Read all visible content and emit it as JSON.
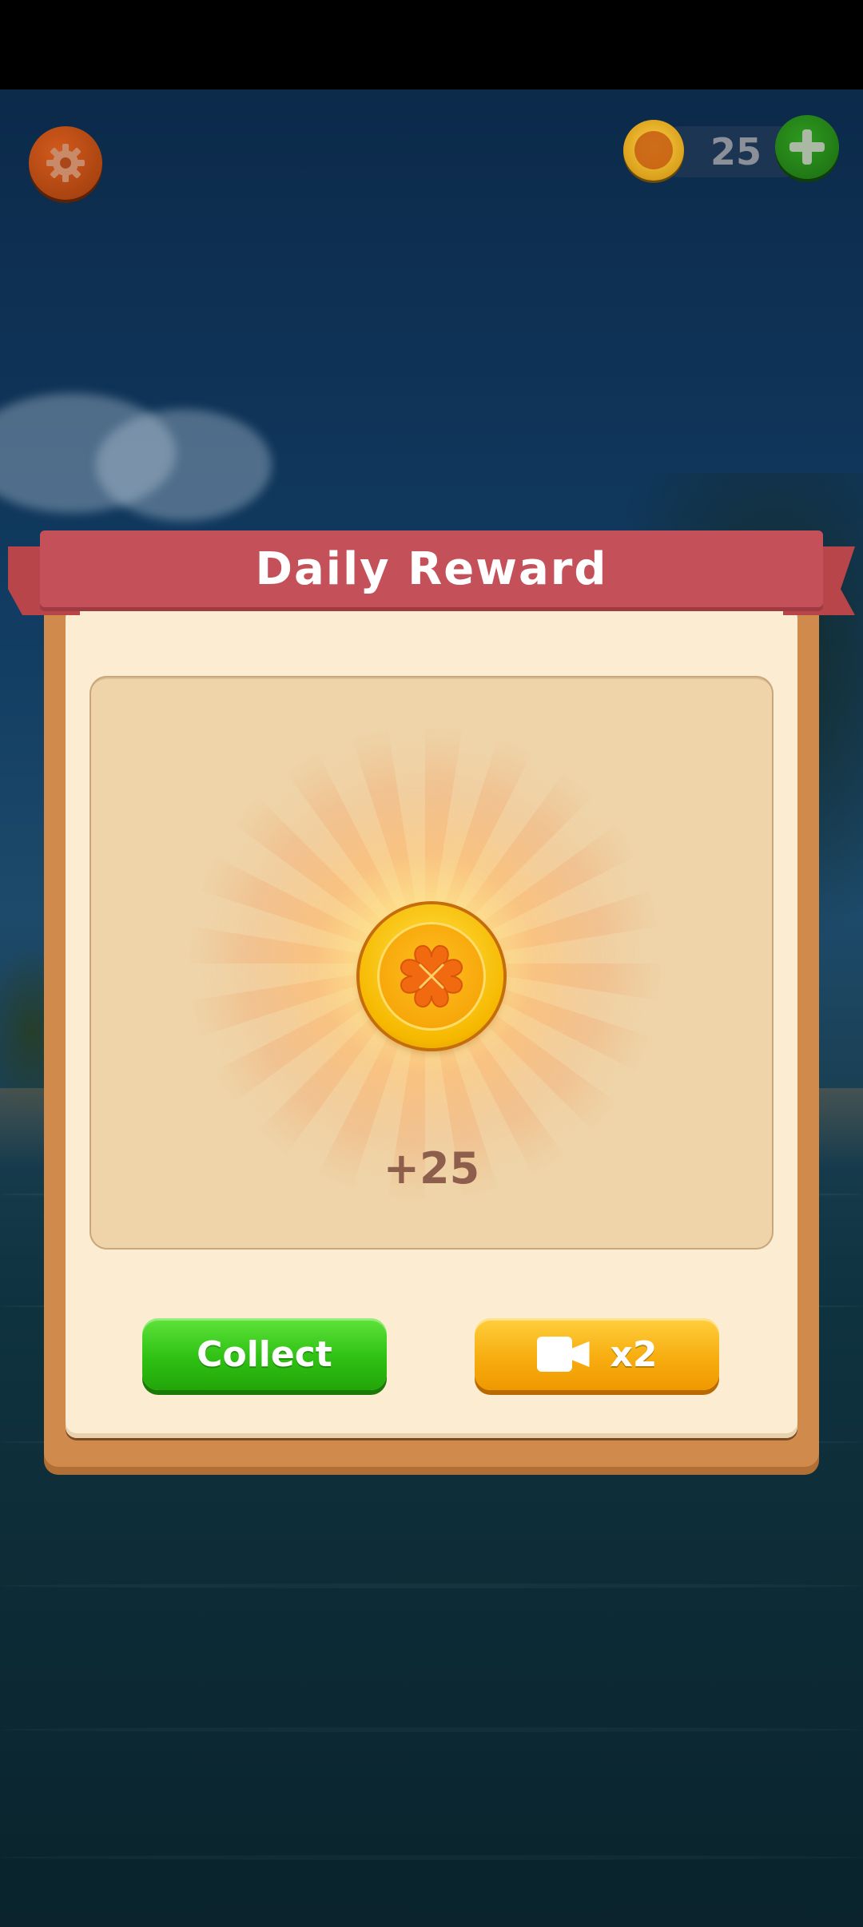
{
  "hud": {
    "settings_icon": "gear-icon",
    "coin_count": "25",
    "add_coins_icon": "plus-icon"
  },
  "dialog": {
    "title": "Daily Reward",
    "reward_icon": "clover-coin-icon",
    "reward_amount": "+25",
    "collect_label": "Collect",
    "double_icon": "video-camera-icon",
    "double_label": "x2"
  },
  "colors": {
    "ribbon": "#c4505a",
    "collect_button": "#2fc114",
    "double_button": "#f7ad10",
    "dialog_frame": "#cf8a4c",
    "dialog_body": "#fbecd2"
  }
}
